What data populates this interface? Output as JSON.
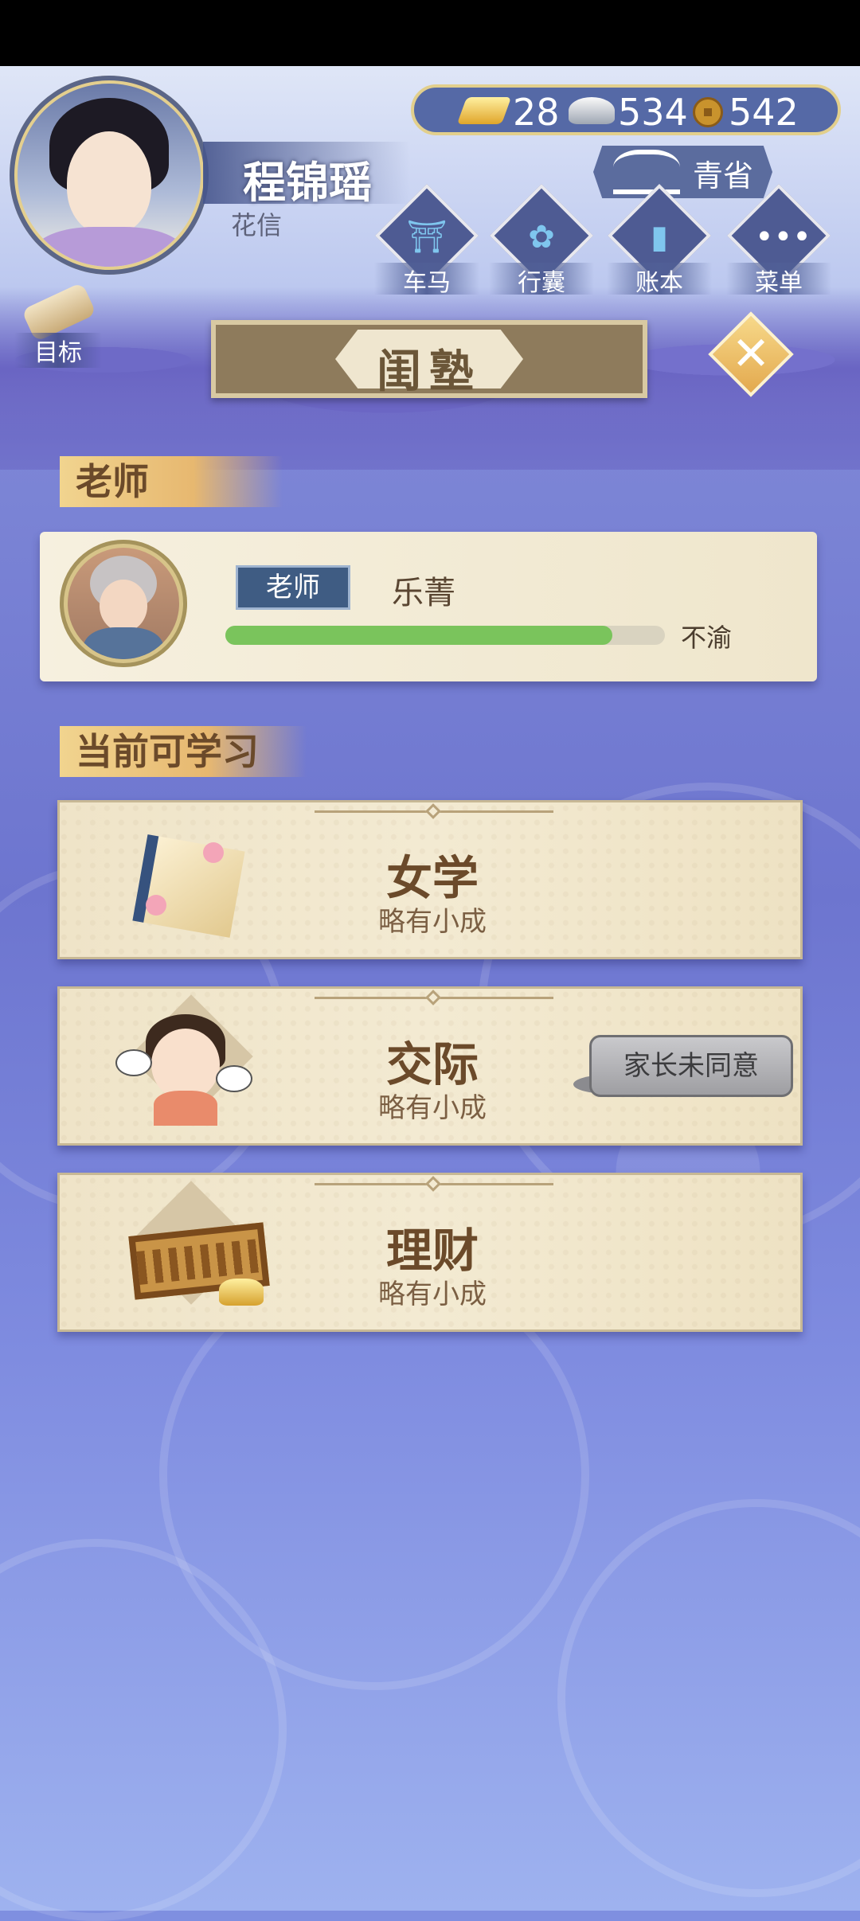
{
  "player": {
    "name": "程锦瑶",
    "subtitle": "花信"
  },
  "currency": {
    "gold": "28",
    "silver": "534",
    "coins": "542"
  },
  "greeting_button": {
    "label": "青省"
  },
  "nav": [
    {
      "label": "车马",
      "icon": "carriage-icon"
    },
    {
      "label": "行囊",
      "icon": "bag-icon"
    },
    {
      "label": "账本",
      "icon": "ledger-icon"
    },
    {
      "label": "菜单",
      "icon": "menu-dots-icon"
    }
  ],
  "goal": {
    "label": "目标"
  },
  "page": {
    "title": "闺塾"
  },
  "teacher_section": {
    "heading": "老师",
    "tag": "老师",
    "name": "乐菁",
    "mood": "不渝",
    "mood_level": 0.88
  },
  "courses_section": {
    "heading": "当前可学习",
    "courses": [
      {
        "title": "女学",
        "level": "略有小成",
        "icon": "book-icon",
        "locked_label": ""
      },
      {
        "title": "交际",
        "level": "略有小成",
        "icon": "chatting-girl-icon",
        "locked_label": "家长未同意"
      },
      {
        "title": "理财",
        "level": "略有小成",
        "icon": "abacus-icon",
        "locked_label": ""
      }
    ]
  },
  "colors": {
    "accent_gold": "#e7b870",
    "header_blue": "#5569a6",
    "progress_green": "#7ac45c",
    "card_paper": "#f3ead2",
    "heading_brown": "#6b4a2a"
  }
}
